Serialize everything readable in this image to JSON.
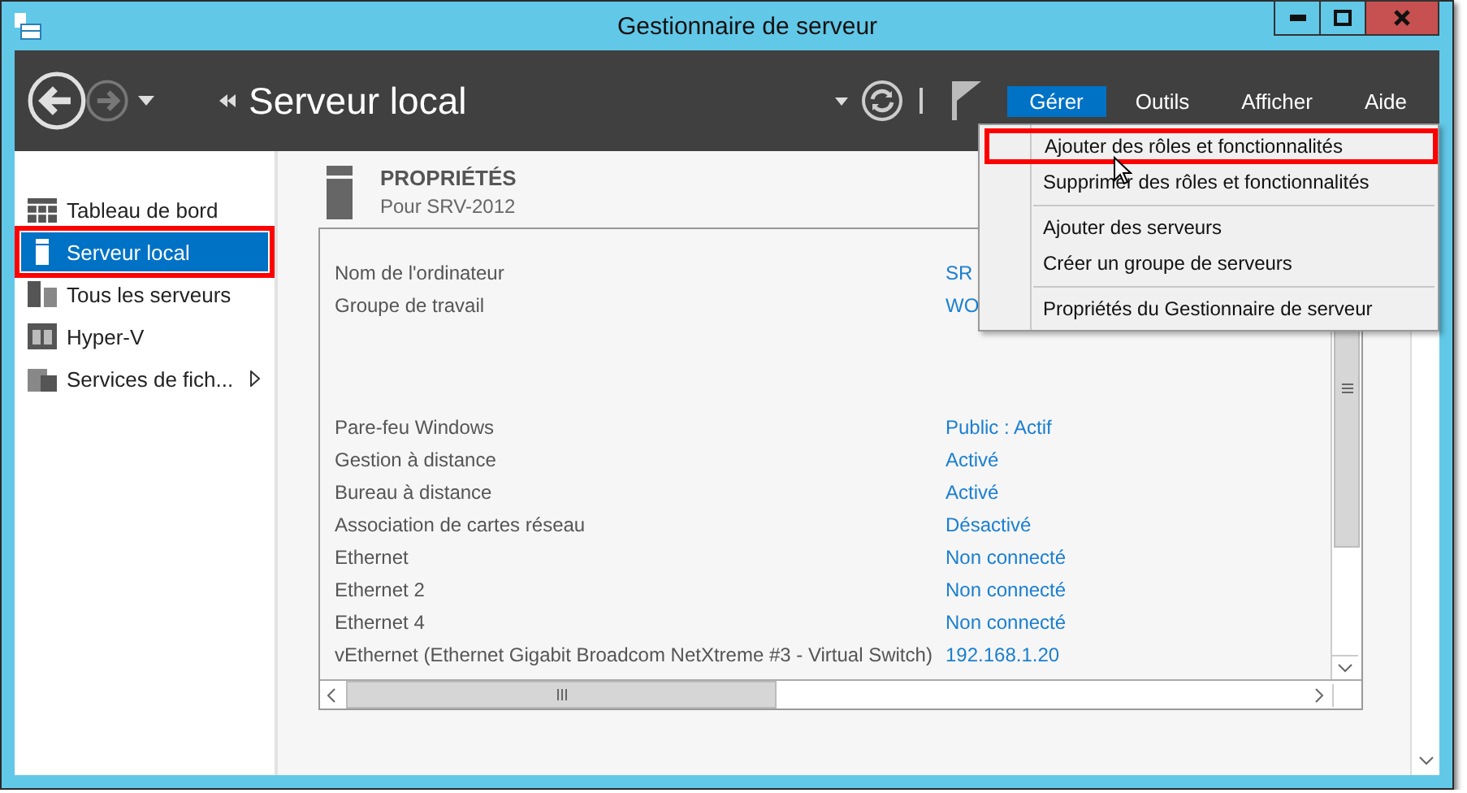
{
  "window": {
    "title": "Gestionnaire de serveur"
  },
  "header": {
    "title": "Serveur local"
  },
  "menu_bar": [
    {
      "label": "Gérer",
      "selected": true
    },
    {
      "label": "Outils",
      "selected": false
    },
    {
      "label": "Afficher",
      "selected": false
    },
    {
      "label": "Aide",
      "selected": false
    }
  ],
  "sidebar": {
    "items": [
      {
        "kind": "dashboard",
        "label": "Tableau de bord",
        "selected": false,
        "highlighted": false,
        "submenu": false
      },
      {
        "kind": "server",
        "label": "Serveur local",
        "selected": true,
        "highlighted": true,
        "submenu": false
      },
      {
        "kind": "servers",
        "label": "Tous les serveurs",
        "selected": false,
        "highlighted": false,
        "submenu": false
      },
      {
        "kind": "hyperv",
        "label": "Hyper-V",
        "selected": false,
        "highlighted": false,
        "submenu": false
      },
      {
        "kind": "files",
        "label": "Services de fich...",
        "selected": false,
        "highlighted": false,
        "submenu": true
      }
    ]
  },
  "properties": {
    "title": "PROPRIÉTÉS",
    "subtitle": "Pour SRV-2012",
    "groups": [
      [
        {
          "label": "Nom de l'ordinateur",
          "value": "SR"
        },
        {
          "label": "Groupe de travail",
          "value": "WO"
        }
      ],
      [
        {
          "label": "Pare-feu Windows",
          "value": "Public : Actif"
        },
        {
          "label": "Gestion à distance",
          "value": "Activé"
        },
        {
          "label": "Bureau à distance",
          "value": "Activé"
        },
        {
          "label": "Association de cartes réseau",
          "value": "Désactivé"
        },
        {
          "label": "Ethernet",
          "value": "Non connecté"
        },
        {
          "label": "Ethernet 2",
          "value": "Non connecté"
        },
        {
          "label": "Ethernet 4",
          "value": "Non connecté"
        },
        {
          "label": "vEthernet (Ethernet Gigabit Broadcom NetXtreme #3 - Virtual Switch)",
          "value": "192.168.1.20"
        }
      ]
    ]
  },
  "dropdown_menu": {
    "sections": [
      [
        {
          "label": "Ajouter des rôles et fonctionnalités",
          "highlighted": true
        },
        {
          "label": "Supprimer des rôles et fonctionnalités",
          "highlighted": false
        }
      ],
      [
        {
          "label": "Ajouter des serveurs",
          "highlighted": false
        },
        {
          "label": "Créer un groupe de serveurs",
          "highlighted": false
        }
      ],
      [
        {
          "label": "Propriétés du Gestionnaire de serveur",
          "highlighted": false
        }
      ]
    ]
  }
}
